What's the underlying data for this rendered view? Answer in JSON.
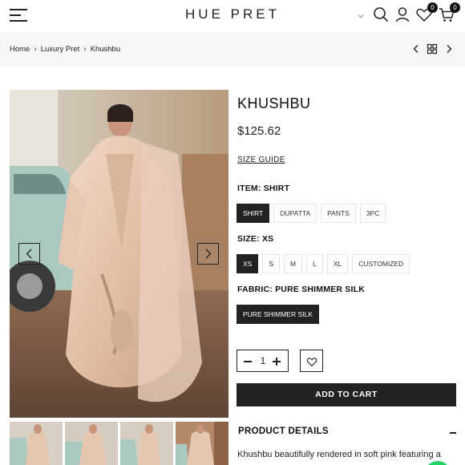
{
  "header": {
    "logo": "HUE PRET",
    "wishlist_count": "0",
    "cart_count": "0",
    "icons": [
      "menu-icon",
      "chevron-down-icon",
      "search-icon",
      "account-icon",
      "heart-icon",
      "cart-icon"
    ]
  },
  "breadcrumb": {
    "items": [
      "Home",
      "Luxury Pret",
      "Khushbu"
    ]
  },
  "product": {
    "title": "KHUSHBU",
    "price": "$125.62",
    "size_guide": "SIZE GUIDE",
    "item": {
      "label": "ITEM: SHIRT",
      "options": [
        "SHIRT",
        "DUPATTA",
        "PANTS",
        "3PC"
      ],
      "selected": "SHIRT"
    },
    "size": {
      "label": "SIZE: XS",
      "options": [
        "XS",
        "S",
        "M",
        "L",
        "XL",
        "CUSTOMIZED"
      ],
      "selected": "XS"
    },
    "fabric": {
      "label": "FABRIC: PURE SHIMMER SILK",
      "options": [
        "PURE SHIMMER SILK"
      ],
      "selected": "PURE SHIMMER SILK"
    },
    "quantity": "1",
    "add_to_cart": "ADD TO CART",
    "details_heading": "PRODUCT DETAILS",
    "details_text": "Khushbu beautifully rendered in soft pink featuring a"
  },
  "colors": {
    "dark": "#222222",
    "breadcrumb_bg": "#f6f6f8",
    "chat": "#25d366"
  }
}
